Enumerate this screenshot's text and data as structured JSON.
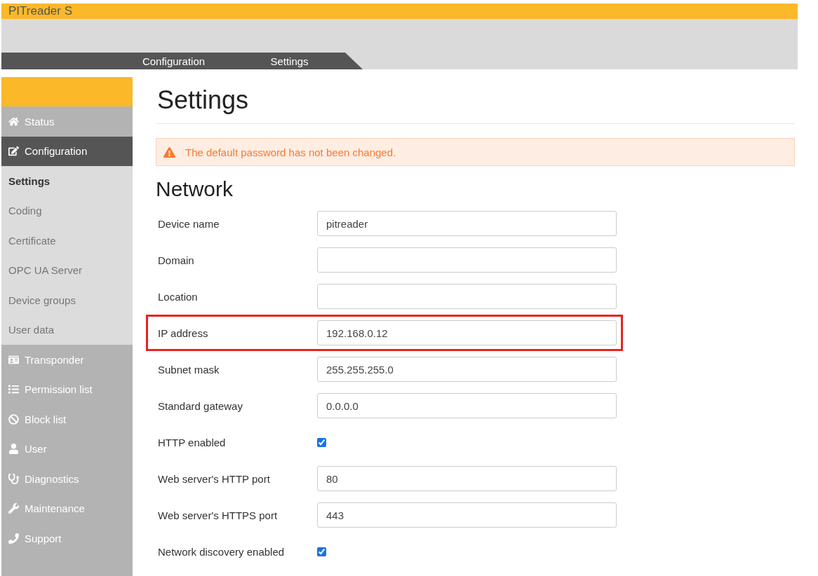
{
  "app": {
    "title": "PITreader S"
  },
  "breadcrumb": [
    {
      "label": "Configuration"
    },
    {
      "label": "Settings"
    }
  ],
  "sidebar": {
    "items": [
      {
        "kind": "main",
        "label": "Status",
        "selected": false
      },
      {
        "kind": "main",
        "label": "Configuration",
        "selected": true
      },
      {
        "kind": "sub",
        "label": "Settings",
        "selected": true
      },
      {
        "kind": "sub",
        "label": "Coding",
        "selected": false
      },
      {
        "kind": "sub",
        "label": "Certificate",
        "selected": false
      },
      {
        "kind": "sub",
        "label": "OPC UA Server",
        "selected": false
      },
      {
        "kind": "sub",
        "label": "Device groups",
        "selected": false
      },
      {
        "kind": "sub",
        "label": "User data",
        "selected": false
      },
      {
        "kind": "main",
        "label": "Transponder",
        "selected": false
      },
      {
        "kind": "main",
        "label": "Permission list",
        "selected": false
      },
      {
        "kind": "main",
        "label": "Block list",
        "selected": false
      },
      {
        "kind": "main",
        "label": "User",
        "selected": false
      },
      {
        "kind": "main",
        "label": "Diagnostics",
        "selected": false
      },
      {
        "kind": "main",
        "label": "Maintenance",
        "selected": false
      },
      {
        "kind": "main",
        "label": "Support",
        "selected": false
      }
    ]
  },
  "page": {
    "title": "Settings",
    "warning": "The default password has not been changed.",
    "section": "Network",
    "fields": [
      {
        "kind": "text",
        "label": "Device name",
        "value": "pitreader",
        "highlighted": false
      },
      {
        "kind": "text",
        "label": "Domain",
        "highlighted": false
      },
      {
        "kind": "text",
        "label": "Location",
        "highlighted": false
      },
      {
        "kind": "text",
        "label": "IP address",
        "value": "192.168.0.12",
        "highlighted": true
      },
      {
        "kind": "text",
        "label": "Subnet mask",
        "value": "255.255.255.0",
        "highlighted": false
      },
      {
        "kind": "text",
        "label": "Standard gateway",
        "value": "0.0.0.0",
        "highlighted": false
      },
      {
        "kind": "checkbox",
        "label": "HTTP enabled",
        "checked": true,
        "highlighted": false
      },
      {
        "kind": "text",
        "label": "Web server's HTTP port",
        "value": "80",
        "highlighted": false
      },
      {
        "kind": "text",
        "label": "Web server's HTTPS port",
        "value": "443",
        "highlighted": false
      },
      {
        "kind": "checkbox",
        "label": "Network discovery enabled",
        "checked": true,
        "highlighted": false
      }
    ]
  }
}
